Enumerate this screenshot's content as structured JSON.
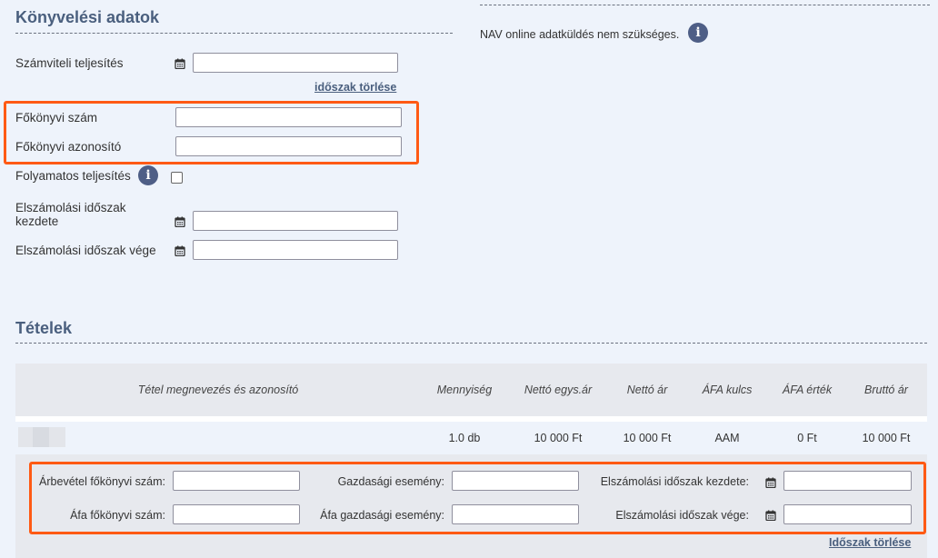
{
  "booking": {
    "title": "Könyvelési adatok",
    "accounting_fulfillment_label": "Számviteli teljesítés",
    "accounting_fulfillment_value": "",
    "clear_period_link": "időszak törlése",
    "ledger_number_label": "Főkönyvi szám",
    "ledger_number_value": "",
    "ledger_id_label": "Főkönyvi azonosító",
    "ledger_id_value": "",
    "continuous_fulfillment_label": "Folyamatos teljesítés",
    "continuous_fulfillment_checked": false,
    "period_start_label": "Elszámolási időszak kezdete",
    "period_start_value": "",
    "period_end_label": "Elszámolási időszak vége",
    "period_end_value": ""
  },
  "nav": {
    "text": "NAV online adatküldés nem szükséges."
  },
  "items": {
    "title": "Tételek",
    "columns": [
      "Tétel megnevezés és azonosító",
      "Mennyiség",
      "Nettó egys.ár",
      "Nettó ár",
      "ÁFA kulcs",
      "ÁFA érték",
      "Bruttó ár"
    ],
    "rows": [
      {
        "name": "",
        "quantity": "1.0 db",
        "unit_price": "10 000 Ft",
        "net_price": "10 000 Ft",
        "vat_rate": "AAM",
        "vat_value": "0 Ft",
        "gross_price": "10 000 Ft"
      }
    ],
    "detail": {
      "revenue_ledger_label": "Árbevétel főkönyvi szám:",
      "revenue_ledger_value": "",
      "vat_ledger_label": "Áfa főkönyvi szám:",
      "vat_ledger_value": "",
      "economic_event_label": "Gazdasági esemény:",
      "economic_event_value": "",
      "vat_economic_event_label": "Áfa gazdasági esemény:",
      "vat_economic_event_value": "",
      "period_start_label": "Elszámolási időszak kezdete:",
      "period_start_value": "",
      "period_end_label": "Elszámolási időszak vége:",
      "period_end_value": "",
      "clear_period_link": "Időszak törlése"
    }
  },
  "colors": {
    "highlight": "#ff5a14",
    "title": "#4a5f7e",
    "info_icon": "#4e5e86"
  }
}
